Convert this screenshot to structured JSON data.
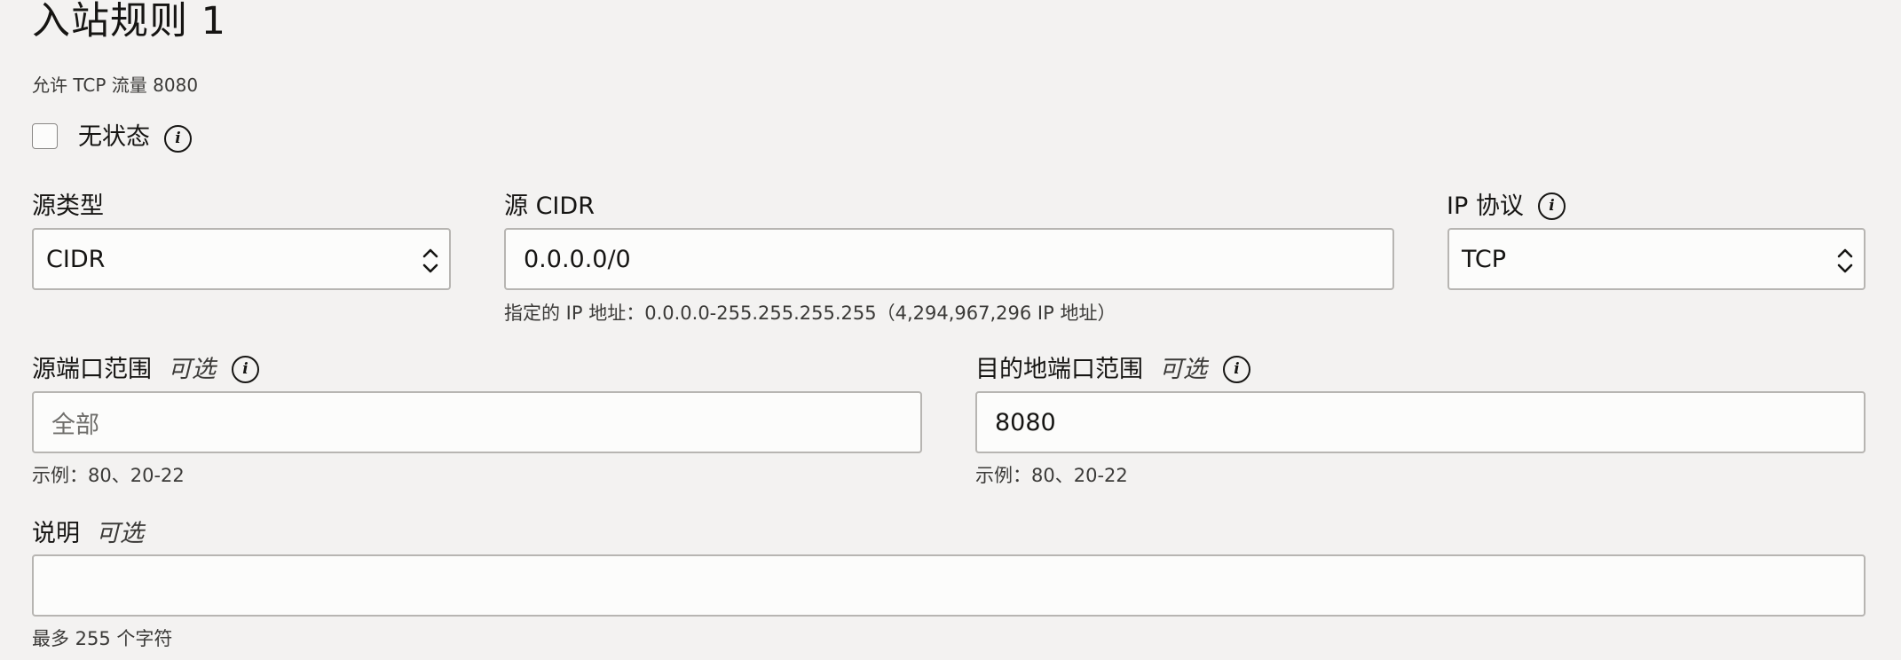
{
  "rule": {
    "title": "入站规则 1",
    "subtitle": "允许 TCP 流量 8080"
  },
  "stateless": {
    "label": "无状态",
    "checked": false,
    "info_icon": "info-icon"
  },
  "source_type": {
    "label": "源类型",
    "value": "CIDR",
    "icon": "up-down-chevron-icon"
  },
  "source_cidr": {
    "label": "源 CIDR",
    "value": "0.0.0.0/0",
    "hint": "指定的 IP 地址：0.0.0.0-255.255.255.255（4,294,967,296 IP 地址）"
  },
  "ip_protocol": {
    "label": "IP 协议",
    "value": "TCP",
    "info_icon": "info-icon",
    "icon": "up-down-chevron-icon"
  },
  "source_port_range": {
    "label": "源端口范围",
    "optional": "可选",
    "placeholder": "全部",
    "value": "",
    "hint": "示例：80、20-22",
    "info_icon": "info-icon"
  },
  "destination_port_range": {
    "label": "目的地端口范围",
    "optional": "可选",
    "value": "8080",
    "hint": "示例：80、20-22",
    "info_icon": "info-icon"
  },
  "description": {
    "label": "说明",
    "optional": "可选",
    "value": "",
    "hint": "最多 255 个字符"
  },
  "colors": {
    "background": "#f3f2f1",
    "field_background": "#fcfcfb",
    "field_border": "#b7b5b2",
    "text": "#161513",
    "muted_text": "#3b3a38"
  }
}
